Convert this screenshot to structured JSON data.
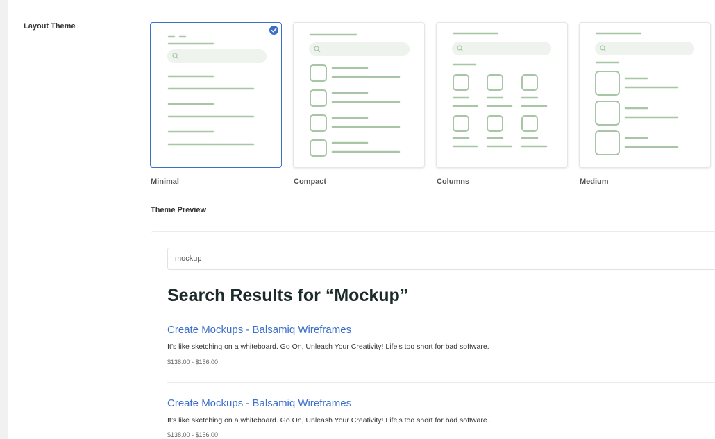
{
  "layout_theme": {
    "label": "Layout Theme",
    "selected": "Minimal",
    "accent_color": "#3b6fc9",
    "wire_color": "#a8c6a6",
    "themes": [
      {
        "name": "Minimal",
        "selected": true
      },
      {
        "name": "Compact",
        "selected": false
      },
      {
        "name": "Columns",
        "selected": false
      },
      {
        "name": "Medium",
        "selected": false
      }
    ]
  },
  "preview": {
    "label": "Theme Preview",
    "search_value": "mockup",
    "heading": "Search Results for “Mockup”",
    "results": [
      {
        "title": "Create Mockups - Balsamiq Wireframes",
        "description": "It’s like sketching on a whiteboard. Go On, Unleash Your Creativity! Life’s too short for bad software.",
        "price": "$138.00 - $156.00"
      },
      {
        "title": "Create Mockups - Balsamiq Wireframes",
        "description": "It’s like sketching on a whiteboard. Go On, Unleash Your Creativity! Life’s too short for bad software.",
        "price": "$138.00 - $156.00"
      }
    ]
  }
}
